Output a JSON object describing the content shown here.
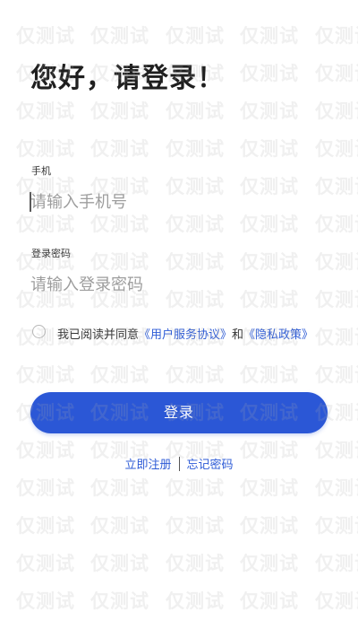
{
  "title": "您好，请登录！",
  "phone": {
    "label": "手机",
    "placeholder": "请输入手机号",
    "value": ""
  },
  "password": {
    "label": "登录密码",
    "placeholder": "请输入登录密码",
    "value": ""
  },
  "agreement": {
    "checked": false,
    "prefix": "我已阅读并同意",
    "user_agreement": "《用户服务协议》",
    "and": "和",
    "privacy_policy": "《隐私政策》"
  },
  "login_button": "登录",
  "bottom": {
    "register": "立即注册",
    "forgot_password": "忘记密码"
  },
  "watermark": "仅测试",
  "colors": {
    "accent": "#2b57d6",
    "link": "#2d5bd6"
  }
}
